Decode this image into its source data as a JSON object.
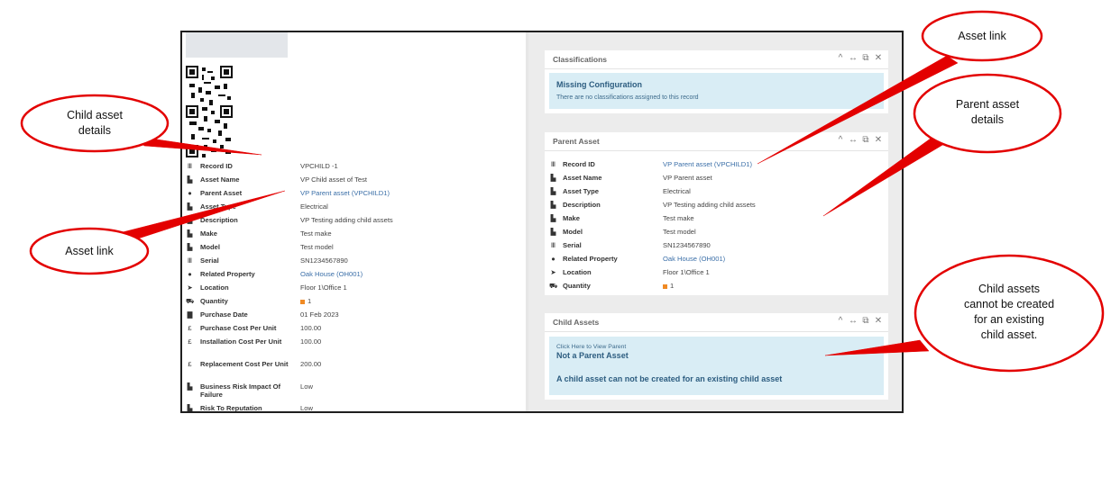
{
  "left_rows": [
    {
      "icon": "barcode-icon",
      "glyph": "Ⅲ",
      "label": "Record ID",
      "value": "VPCHILD -1",
      "link": false
    },
    {
      "icon": "document-icon",
      "glyph": "▙",
      "label": "Asset Name",
      "value": "VP Child asset of Test",
      "link": false
    },
    {
      "icon": "info-icon",
      "glyph": "●",
      "label": "Parent Asset",
      "value": "VP Parent asset (VPCHILD1)",
      "link": true
    },
    {
      "icon": "document-icon",
      "glyph": "▙",
      "label": "Asset Type",
      "value": "Electrical",
      "link": false
    },
    {
      "icon": "document-icon",
      "glyph": "▙",
      "label": "Description",
      "value": "VP Testing adding child assets",
      "link": false
    },
    {
      "icon": "document-icon",
      "glyph": "▙",
      "label": "Make",
      "value": "Test make",
      "link": false
    },
    {
      "icon": "document-icon",
      "glyph": "▙",
      "label": "Model",
      "value": "Test model",
      "link": false
    },
    {
      "icon": "barcode-icon",
      "glyph": "Ⅲ",
      "label": "Serial",
      "value": "SN1234567890",
      "link": false
    },
    {
      "icon": "info-icon",
      "glyph": "●",
      "label": "Related Property",
      "value": "Oak House (OH001)",
      "link": true
    },
    {
      "icon": "location-arrow-icon",
      "glyph": "➤",
      "label": "Location",
      "value": "Floor 1\\Office 1",
      "link": false
    },
    {
      "icon": "truck-icon",
      "glyph": "⛟",
      "label": "Quantity",
      "value": "1",
      "link": false,
      "qty": true
    },
    {
      "icon": "calendar-icon",
      "glyph": "▇",
      "label": "Purchase Date",
      "value": "01 Feb 2023",
      "link": false
    },
    {
      "icon": "pound-icon",
      "glyph": "£",
      "label": "Purchase Cost Per Unit",
      "value": "100.00",
      "link": false
    },
    {
      "icon": "pound-icon",
      "glyph": "£",
      "label": "Installation Cost Per Unit",
      "value": "100.00",
      "link": false
    },
    {
      "icon": "pound-icon",
      "glyph": "£",
      "label": "Replacement Cost Per Unit",
      "value": "200.00",
      "link": false
    },
    {
      "icon": "document-icon",
      "glyph": "▙",
      "label": "Business Risk Impact Of Failure",
      "value": "Low",
      "link": false
    },
    {
      "icon": "document-icon",
      "glyph": "▙",
      "label": "Risk To Reputation",
      "value": "Low",
      "link": false
    }
  ],
  "classifications": {
    "title": "Classifications",
    "box_title": "Missing Configuration",
    "box_text": "There are no classifications assigned to this record"
  },
  "parent_asset": {
    "title": "Parent Asset",
    "rows": [
      {
        "icon": "barcode-icon",
        "glyph": "Ⅲ",
        "label": "Record ID",
        "value": "VP Parent asset (VPCHILD1)",
        "link": true
      },
      {
        "icon": "document-icon",
        "glyph": "▙",
        "label": "Asset Name",
        "value": "VP Parent asset",
        "link": false
      },
      {
        "icon": "document-icon",
        "glyph": "▙",
        "label": "Asset Type",
        "value": "Electrical",
        "link": false
      },
      {
        "icon": "document-icon",
        "glyph": "▙",
        "label": "Description",
        "value": "VP Testing adding child assets",
        "link": false
      },
      {
        "icon": "document-icon",
        "glyph": "▙",
        "label": "Make",
        "value": "Test make",
        "link": false
      },
      {
        "icon": "document-icon",
        "glyph": "▙",
        "label": "Model",
        "value": "Test model",
        "link": false
      },
      {
        "icon": "barcode-icon",
        "glyph": "Ⅲ",
        "label": "Serial",
        "value": "SN1234567890",
        "link": false
      },
      {
        "icon": "info-icon",
        "glyph": "●",
        "label": "Related Property",
        "value": "Oak House (OH001)",
        "link": true
      },
      {
        "icon": "location-arrow-icon",
        "glyph": "➤",
        "label": "Location",
        "value": "Floor 1\\Office 1",
        "link": false
      },
      {
        "icon": "truck-icon",
        "glyph": "⛟",
        "label": "Quantity",
        "value": "1",
        "link": false,
        "qty": true
      }
    ]
  },
  "child_assets": {
    "title": "Child Assets",
    "small_link": "Click Here to View Parent",
    "box_title": "Not a Parent Asset",
    "message": "A child asset can not be created for an existing child asset"
  },
  "panel_tools": {
    "collapse": "^",
    "expand": "↔",
    "popout": "⧉",
    "close": "✕"
  },
  "annotations": {
    "child_details": "Child asset\ndetails",
    "asset_link_left": "Asset link",
    "asset_link_right": "Asset link",
    "parent_details": "Parent asset\ndetails",
    "child_cannot": "Child assets\ncannot be created\nfor an existing\nchild asset."
  },
  "colors": {
    "callout_red": "#e30000",
    "link_blue": "#3b6fa8",
    "info_bg": "#d9edf5",
    "qty_orange": "#f08a24"
  }
}
